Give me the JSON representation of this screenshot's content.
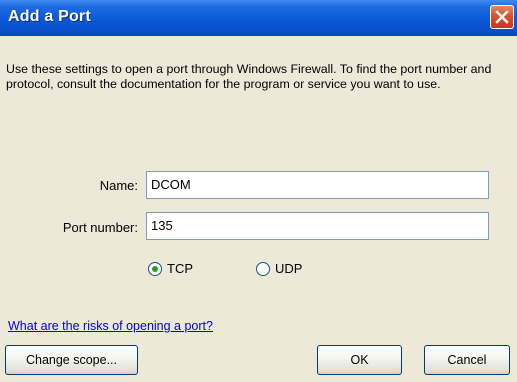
{
  "window": {
    "title": "Add a Port"
  },
  "description": "Use these settings to open a port through Windows Firewall. To find the port number and protocol, consult the documentation for the program or service you want to use.",
  "form": {
    "name_label": "Name:",
    "name_value": "DCOM",
    "port_label": "Port number:",
    "port_value": "135"
  },
  "protocol": {
    "options": [
      {
        "label": "TCP",
        "selected": true
      },
      {
        "label": "UDP",
        "selected": false
      }
    ]
  },
  "link_text": "What are the risks of opening a port?",
  "buttons": {
    "change_scope": "Change scope...",
    "ok": "OK",
    "cancel": "Cancel"
  },
  "colors": {
    "titlebar": "#0a58d8",
    "window_bg": "#ece9d8",
    "close_button": "#d9512c",
    "radio_selected": "#21a121",
    "link": "#0000ee"
  },
  "icons": {
    "close": "close-icon"
  }
}
